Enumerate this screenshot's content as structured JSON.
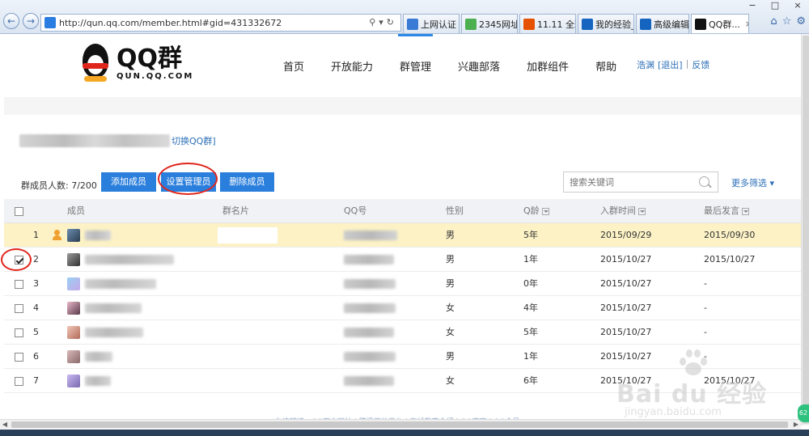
{
  "browser": {
    "url": "http://qun.qq.com/member.html#gid=431332672",
    "tabs": [
      {
        "label": "上网认证",
        "color": "#3a7bd5"
      },
      {
        "label": "2345网址...",
        "color": "#4caf50"
      },
      {
        "label": "11.11 全球...",
        "color": "#e65100"
      },
      {
        "label": "我的经验_...",
        "color": "#1565c0"
      },
      {
        "label": "高级编辑...",
        "color": "#1565c0"
      },
      {
        "label": "QQ群...",
        "color": "#111111"
      }
    ],
    "tab_close": "×",
    "win_controls": [
      "−",
      "□",
      "×"
    ]
  },
  "site": {
    "logo_main": "QQ群",
    "logo_sub": "QUN.QQ.COM",
    "nav": [
      "首页",
      "开放能力",
      "群管理",
      "兴趣部落",
      "加群组件",
      "帮助"
    ],
    "active_nav_index": 2,
    "user_name": "浩渊",
    "logout": "[退出]",
    "sep": "|",
    "feedback": "反馈"
  },
  "group": {
    "switch_link": "切换QQ群]"
  },
  "toolbar": {
    "member_count": "群成员人数: 7/200",
    "add_label": "添加成员",
    "admin_label": "设置管理员",
    "delete_label": "删除成员",
    "search_placeholder": "搜索关键词",
    "more_filter": "更多筛选 ▾"
  },
  "table": {
    "headers": {
      "member": "成员",
      "card": "群名片",
      "qq": "QQ号",
      "gender": "性别",
      "qage": "Q龄",
      "join": "入群时间",
      "last": "最后发言"
    },
    "rows": [
      {
        "num": "1",
        "gender": "男",
        "qage": "5年",
        "join": "2015/09/29",
        "last": "2015/09/30",
        "checked": false,
        "owner": true
      },
      {
        "num": "2",
        "gender": "男",
        "qage": "1年",
        "join": "2015/10/27",
        "last": "2015/10/27",
        "checked": true,
        "owner": false
      },
      {
        "num": "3",
        "gender": "男",
        "qage": "0年",
        "join": "2015/10/27",
        "last": "-",
        "checked": false,
        "owner": false
      },
      {
        "num": "4",
        "gender": "女",
        "qage": "4年",
        "join": "2015/10/27",
        "last": "-",
        "checked": false,
        "owner": false
      },
      {
        "num": "5",
        "gender": "女",
        "qage": "5年",
        "join": "2015/10/27",
        "last": "-",
        "checked": false,
        "owner": false
      },
      {
        "num": "6",
        "gender": "男",
        "qage": "1年",
        "join": "2015/10/27",
        "last": "-",
        "checked": false,
        "owner": false
      },
      {
        "num": "7",
        "gender": "女",
        "qage": "6年",
        "join": "2015/10/27",
        "last": "2015/10/27",
        "checked": false,
        "owner": false
      }
    ]
  },
  "footer": {
    "links": "友情链接：QQ官方网站 | 腾讯开放平台 | 在线教育介绍 | QQ商家 | QQ会员"
  },
  "watermark": {
    "text": "Bai du 经验",
    "url": "jingyan.baidu.com"
  },
  "side_badge": "62",
  "colors": {
    "primary_button": "#2b7fdc",
    "highlight_row": "#fcf2c6",
    "annotation_red": "#e0251b",
    "link_blue": "#2c6fb7"
  }
}
